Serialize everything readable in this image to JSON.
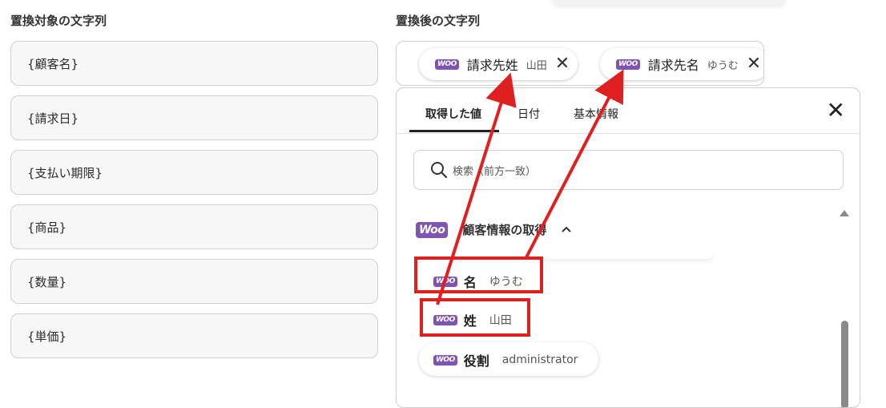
{
  "left": {
    "label": "置換対象の文字列",
    "fields": [
      "{顧客名}",
      "{請求日}",
      "{支払い期限}",
      "{商品}",
      "{数量}",
      "{単価}"
    ]
  },
  "right": {
    "label": "置換後の文字列",
    "chips": [
      {
        "icon": "woo",
        "name": "請求先姓",
        "value": "山田"
      },
      {
        "icon": "woo",
        "name": "請求先名",
        "value": "ゆうむ"
      }
    ]
  },
  "panel": {
    "tabs": [
      "取得した値",
      "日付",
      "基本情報"
    ],
    "active_tab": "取得した値",
    "search_placeholder": "検索（前方一致）",
    "group": {
      "icon_label": "Woo",
      "title": "顧客情報の取得",
      "expanded": true
    },
    "items": [
      {
        "name": "名",
        "value": "ゆうむ",
        "highlighted": true
      },
      {
        "name": "姓",
        "value": "山田",
        "highlighted": true
      },
      {
        "name": "役割",
        "value": "administrator",
        "highlighted": false
      }
    ]
  },
  "woo_small_label": "WOO",
  "colors": {
    "woo_purple": "#7f54b3",
    "highlight_red": "#e02020",
    "arrow_red": "#e02020"
  }
}
